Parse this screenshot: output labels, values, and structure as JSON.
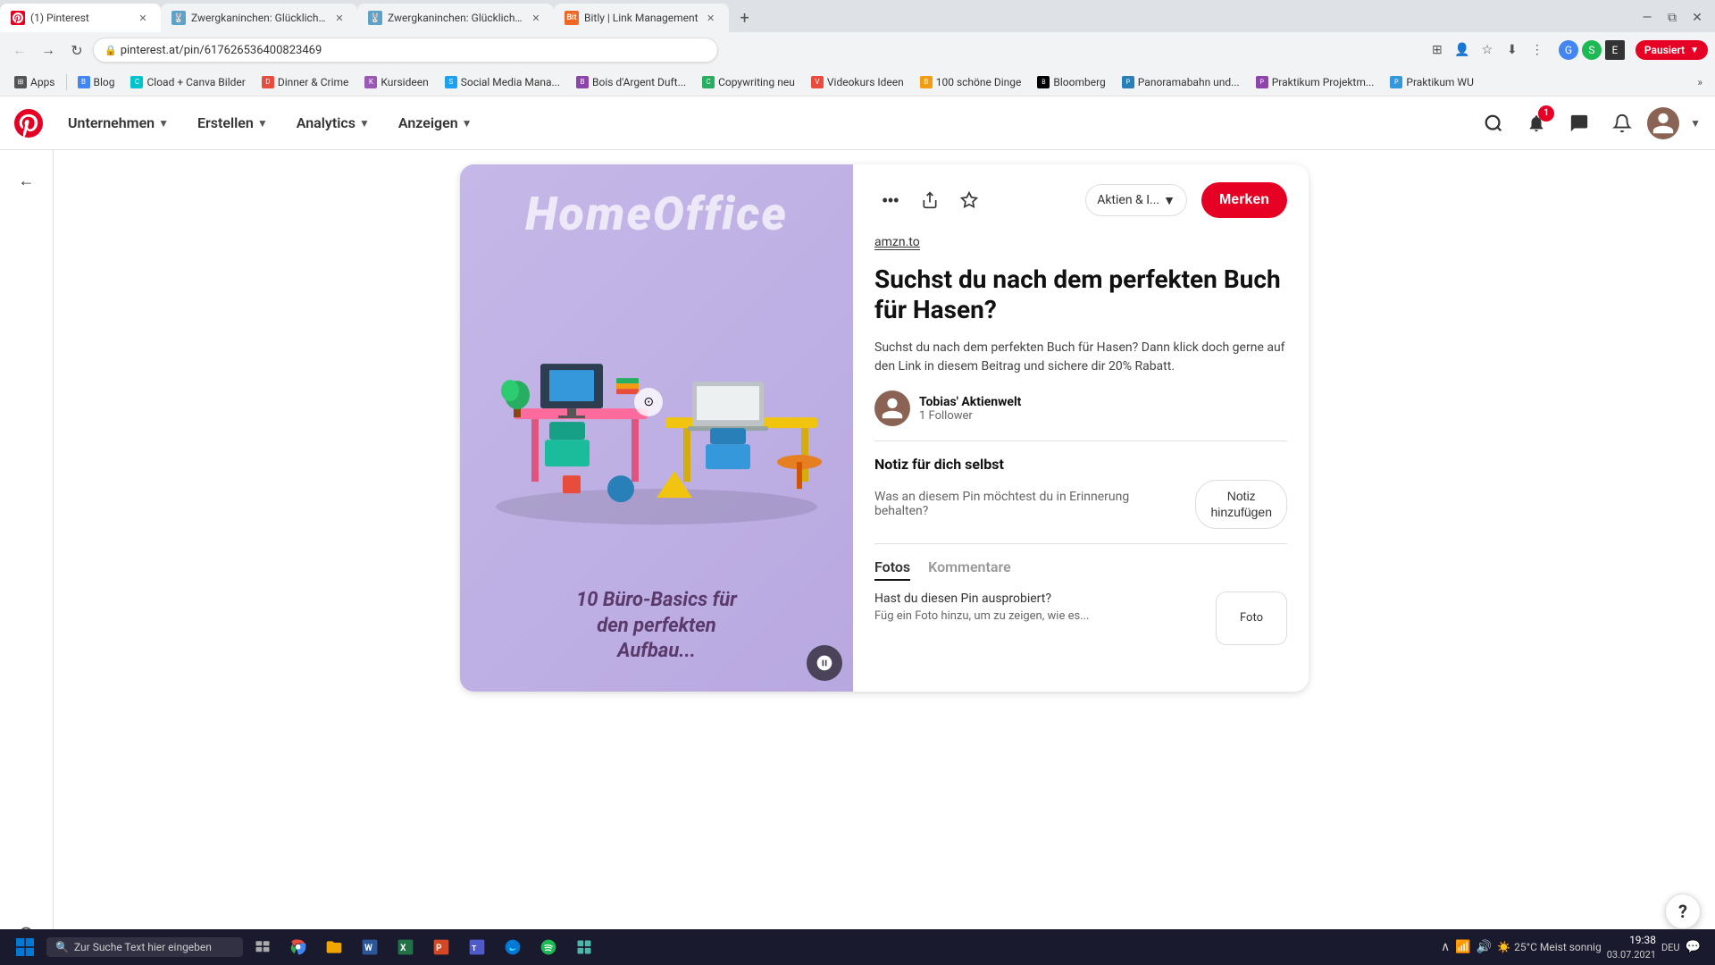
{
  "browser": {
    "tabs": [
      {
        "id": "tab1",
        "favicon": "pinterest",
        "title": "(1) Pinterest",
        "active": true
      },
      {
        "id": "tab2",
        "favicon": "bunny",
        "title": "Zwergkaninchen: Glücklich dur...",
        "active": false
      },
      {
        "id": "tab3",
        "favicon": "bunny2",
        "title": "Zwergkaninchen: Glücklich dur...",
        "active": false
      },
      {
        "id": "tab4",
        "favicon": "bitly",
        "title": "Bitly | Link Management",
        "active": false
      }
    ],
    "address": "pinterest.at/pin/617626536400823469"
  },
  "bookmarks": [
    {
      "id": "bm1",
      "label": "Apps"
    },
    {
      "id": "bm2",
      "label": "Blog"
    },
    {
      "id": "bm3",
      "label": "Cload + Canva Bilder"
    },
    {
      "id": "bm4",
      "label": "Dinner & Crime"
    },
    {
      "id": "bm5",
      "label": "Kursideen"
    },
    {
      "id": "bm6",
      "label": "Social Media Mana..."
    },
    {
      "id": "bm7",
      "label": "Bois d'Argent Duft..."
    },
    {
      "id": "bm8",
      "label": "Copywriting neu"
    },
    {
      "id": "bm9",
      "label": "Videokurs Ideen"
    },
    {
      "id": "bm10",
      "label": "100 schöne Dinge"
    },
    {
      "id": "bm11",
      "label": "Bloomberg"
    },
    {
      "id": "bm12",
      "label": "Panoramabahn und..."
    },
    {
      "id": "bm13",
      "label": "Praktikum Projektm..."
    },
    {
      "id": "bm14",
      "label": "Praktikum WU"
    }
  ],
  "pinterest_nav": {
    "menu_items": [
      {
        "id": "unternehmen",
        "label": "Unternehmen",
        "has_chevron": true
      },
      {
        "id": "erstellen",
        "label": "Erstellen",
        "has_chevron": true
      },
      {
        "id": "analytics",
        "label": "Analytics",
        "has_chevron": true
      },
      {
        "id": "anzeigen",
        "label": "Anzeigen",
        "has_chevron": true
      }
    ],
    "notification_badge": "1"
  },
  "pin": {
    "source_link": "amzn.to",
    "title": "Suchst du nach dem perfekten Buch für Hasen?",
    "description": "Suchst du nach dem perfekten Buch für Hasen? Dann klick doch gerne auf den Link in diesem Beitrag und sichere dir 20% Rabatt.",
    "author_name": "Tobias' Aktienwelt",
    "author_followers": "1 Follower",
    "save_dropdown_label": "Aktien & I...",
    "merken_label": "Merken",
    "notiz_title": "Notiz für dich selbst",
    "notiz_prompt": "Was an diesem Pin möchtest du in Erinnerung behalten?",
    "notiz_btn_line1": "Notiz",
    "notiz_btn_line2": "hinzufügen",
    "fotos_tab": "Fotos",
    "kommentare_tab": "Kommentare",
    "fotos_question": "Hast du diesen Pin ausprobiert?",
    "fotos_sub": "Füg ein Foto hinzu, um zu zeigen, wie es...",
    "foto_btn_label": "Foto",
    "image": {
      "homeoffice_text": "HomeOffice",
      "bottom_text": "10 Büro-Basics für\nden perfekten\nAufbau..."
    }
  },
  "taskbar": {
    "search_placeholder": "Zur Suche Text hier eingeben",
    "weather": "25°C Meist sonnig",
    "time": "19:38",
    "date": "03.07.2021",
    "language": "DEU"
  },
  "help_btn_label": "?"
}
